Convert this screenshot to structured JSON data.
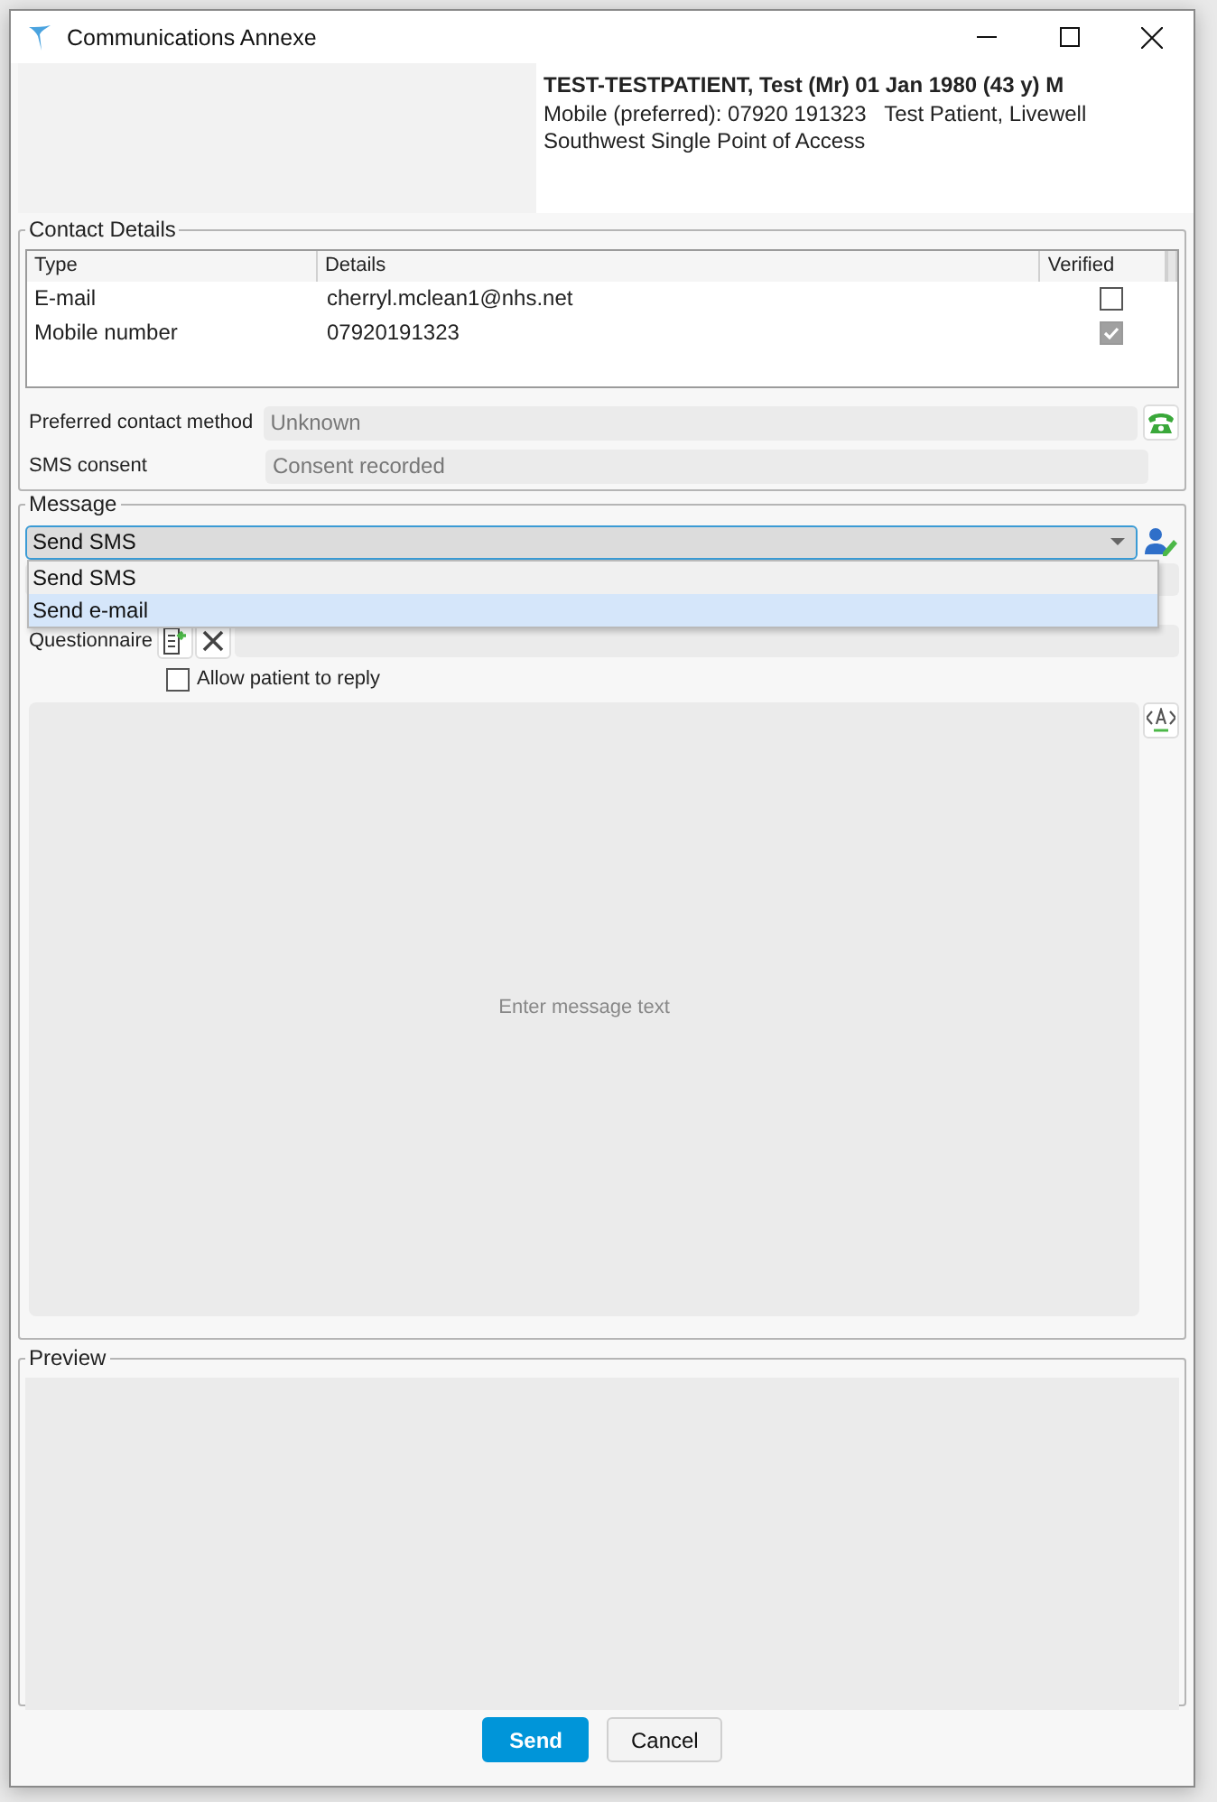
{
  "window": {
    "title": "Communications Annexe"
  },
  "patient_banner": {
    "name_line": "TEST-TESTPATIENT, Test (Mr) 01 Jan 1980 (43 y) M",
    "contact_line": "Mobile (preferred): 07920 191323   Test Patient, Livewell",
    "organisation_line": "Southwest Single Point of Access"
  },
  "contact_details": {
    "title": "Contact Details",
    "columns": [
      "Type",
      "Details",
      "Verified"
    ],
    "rows": [
      {
        "type": "E-mail",
        "details": "cherryl.mclean1@nhs.net",
        "verified": false
      },
      {
        "type": "Mobile number",
        "details": "07920191323",
        "verified": true
      }
    ],
    "fields": [
      {
        "label": "Preferred contact method",
        "value": "Unknown",
        "disabled": true
      },
      {
        "label": "SMS consent",
        "value": "Consent recorded",
        "disabled": true
      }
    ]
  },
  "message": {
    "title": "Message",
    "action": {
      "value": "Send SMS",
      "expanded": true,
      "options": [
        {
          "label": "Send SMS",
          "highlighted": false
        },
        {
          "label": "Send e-mail",
          "highlighted": true
        }
      ]
    },
    "questionnaire": {
      "label": "Questionnaire"
    },
    "allow_reply": {
      "label": "Allow patient to reply",
      "checked": false
    },
    "text": {
      "placeholder": "Enter message text"
    }
  },
  "preview": {
    "title": "Preview"
  },
  "buttons": [
    {
      "label": "Send",
      "kind": "primary"
    },
    {
      "label": "Cancel",
      "kind": "secondary"
    }
  ]
}
